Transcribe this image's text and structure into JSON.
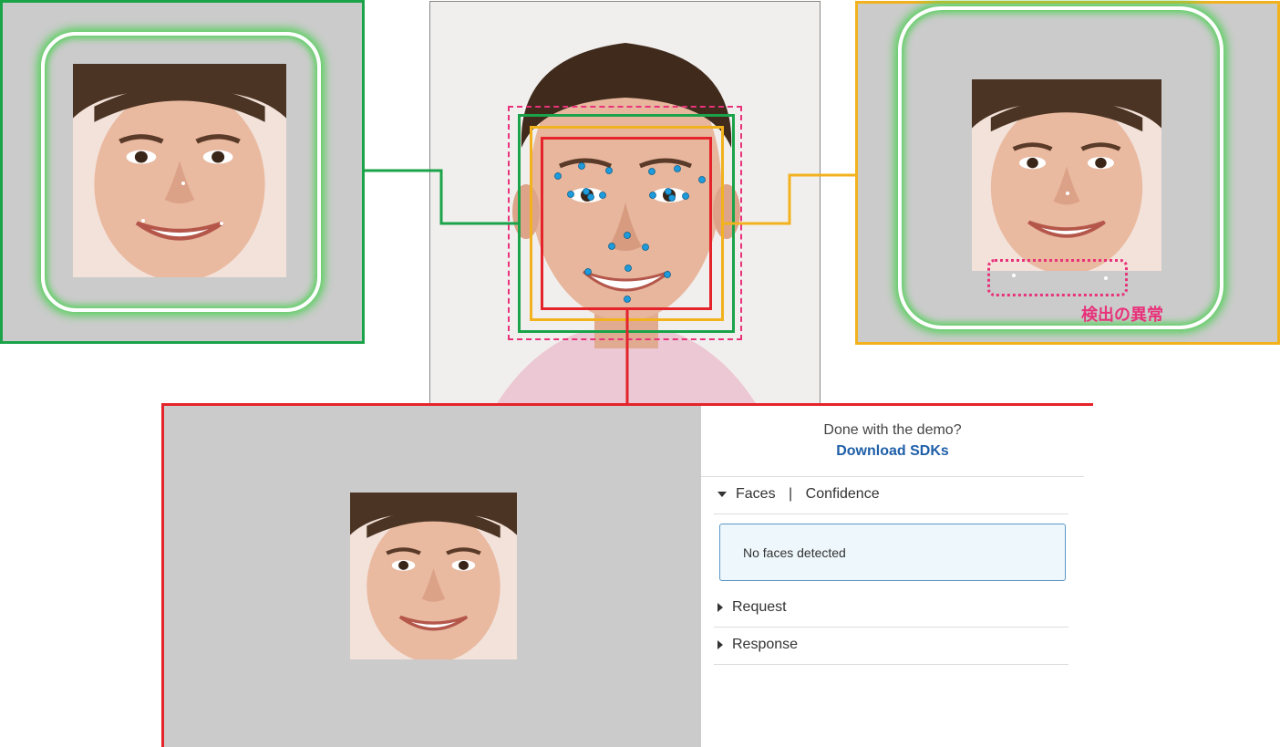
{
  "demo": {
    "done_text": "Done with the demo?",
    "download_link": "Download SDKs",
    "faces_label": "Faces",
    "faces_divider": "|",
    "confidence_label": "Confidence",
    "no_faces_text": "No faces detected",
    "request_label": "Request",
    "response_label": "Response"
  },
  "annotations": {
    "detection_anomaly_label": "検出の異常"
  },
  "colors": {
    "green_box": "#1ba34a",
    "yellow_box": "#f2b21d",
    "red_box": "#e4232a",
    "pink_dashed_box": "#e8327a",
    "landmark_dot": "#1e9bdc",
    "link_blue": "#1f5fa8"
  },
  "icons": {
    "faces_toggle": "caret-down-icon",
    "request_toggle": "caret-right-icon",
    "response_toggle": "caret-right-icon"
  }
}
